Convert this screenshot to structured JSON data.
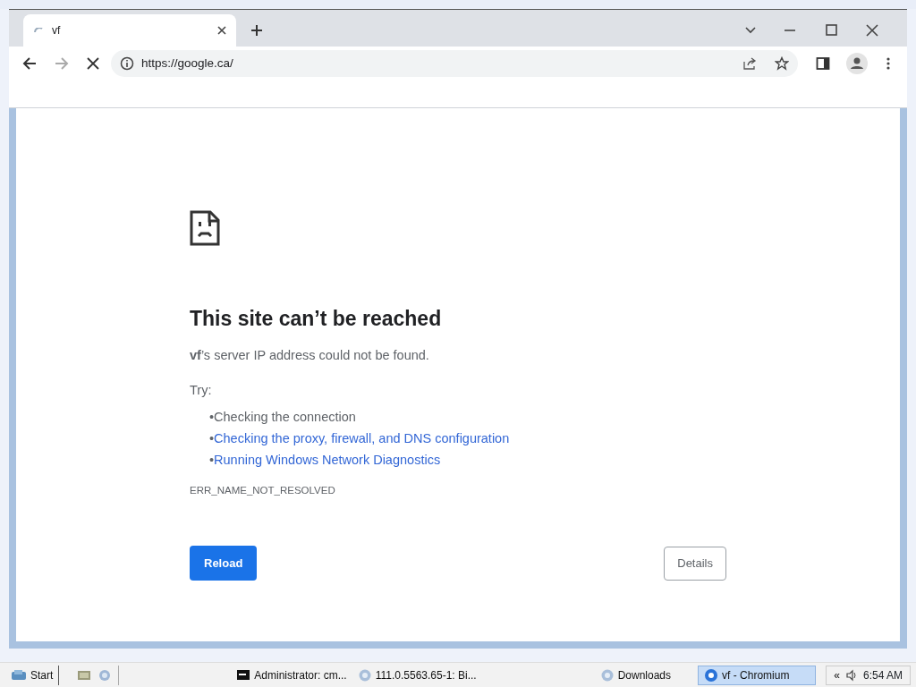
{
  "tabs": [
    {
      "title": "vf",
      "selected": true,
      "loading": true
    }
  ],
  "toolbar": {
    "loading": true,
    "address": "https://google.ca/"
  },
  "error": {
    "heading": "This site can’t be reached",
    "message": "**vf**’s server IP address could not be found.",
    "try_label": "Try:",
    "suggestions": [
      {
        "bullet": "•",
        "text": "Checking the connection",
        "kind": "text"
      },
      {
        "bullet": "•",
        "text": "Checking the proxy, firewall, and DNS configuration",
        "kind": "link"
      },
      {
        "bullet": "•",
        "text": "Running Windows Network Diagnostics",
        "kind": "link"
      }
    ],
    "code": "ERR_NAME_NOT_RESOLVED",
    "reload_button": "Reload",
    "details_button": "Details"
  },
  "taskbar": {
    "start": "Start",
    "tasks": [
      {
        "label": "Administrator: cm...",
        "kind": "console",
        "selected": false
      },
      {
        "label": "111.0.5563.65-1: Bi...",
        "kind": "web",
        "selected": false
      },
      {
        "label": "Downloads",
        "kind": "web",
        "selected": false
      },
      {
        "label": "vf - Chromium",
        "kind": "browser",
        "selected": true
      }
    ],
    "tray_toggle": "«",
    "clock": "6:54 AM"
  }
}
